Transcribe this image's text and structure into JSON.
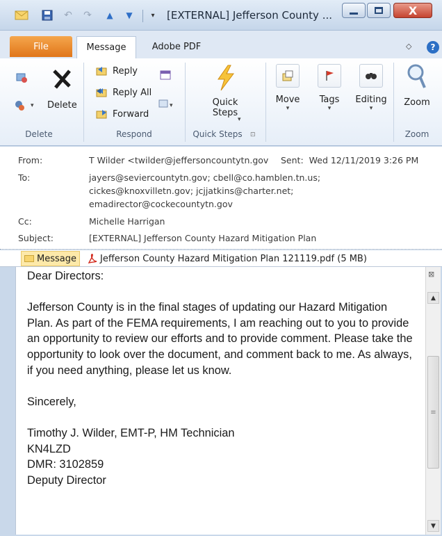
{
  "window": {
    "title": "[EXTERNAL] Jefferson County ...",
    "close_glyph": "X"
  },
  "tabs": {
    "file": "File",
    "message": "Message",
    "adobe_pdf": "Adobe PDF",
    "help_glyph": "?"
  },
  "ribbon": {
    "delete_group": {
      "delete_label": "Delete",
      "group_label": "Delete"
    },
    "respond_group": {
      "reply": "Reply",
      "reply_all": "Reply All",
      "forward": "Forward",
      "group_label": "Respond"
    },
    "quick_steps_group": {
      "label_line1": "Quick",
      "label_line2": "Steps",
      "group_label": "Quick Steps"
    },
    "move": "Move",
    "tags": "Tags",
    "editing": "Editing",
    "zoom": {
      "label": "Zoom",
      "group_label": "Zoom"
    }
  },
  "header": {
    "from_label": "From:",
    "from_value": "T Wilder <twilder@jeffersoncountytn.gov",
    "sent_label": "Sent:",
    "sent_value": "Wed 12/11/2019 3:26 PM",
    "to_label": "To:",
    "to_line1": "jayers@seviercountytn.gov; cbell@co.hamblen.tn.us;",
    "to_line2": "cickes@knoxvilletn.gov; jcjjatkins@charter.net;",
    "to_line3": "emadirector@cockecountytn.gov",
    "cc_label": "Cc:",
    "cc_value": "Michelle Harrigan",
    "subject_label": "Subject:",
    "subject_value": "[EXTERNAL] Jefferson County Hazard Mitigation Plan"
  },
  "attachments": {
    "message_tab": "Message",
    "file": "Jefferson County Hazard Mitigation Plan 121119.pdf (5 MB)"
  },
  "body": {
    "greeting": "Dear Directors:",
    "paragraph": "Jefferson County is in the final stages of updating our Hazard Mitigation Plan. As part of the FEMA requirements, I am reaching out to you to provide an opportunity to review our efforts and to provide comment.  Please take the opportunity to look over the document, and comment back to me.  As always, if you need anything, please let us know.",
    "closing": "Sincerely,",
    "sig_name": "Timothy J. Wilder, EMT-P, HM Technician",
    "sig_call": "KN4LZD",
    "sig_dmr": "DMR: 3102859",
    "sig_title": "Deputy Director"
  },
  "colors": {
    "file_tab": "#e0761a",
    "close_button": "#c54430",
    "help_button": "#2c6fc5",
    "ribbon_bg": "#e6eef8"
  }
}
